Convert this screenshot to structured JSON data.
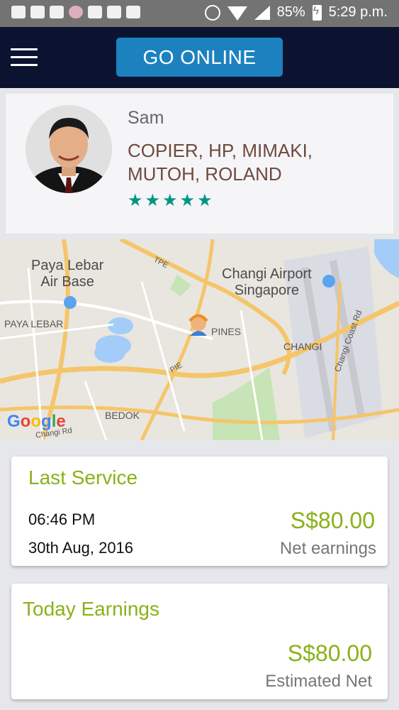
{
  "status_bar": {
    "battery": "85%",
    "time": "5:29 p.m."
  },
  "header": {
    "go_online_label": "GO ONLINE"
  },
  "profile": {
    "name": "Sam",
    "company_line1": "COPIER, HP, MIMAKI,",
    "company_line2": "MUTOH, ROLAND",
    "rating": 5,
    "stars": "★★★★★"
  },
  "map": {
    "labels": {
      "paya_lebar_air_base_line1": "Paya Lebar",
      "paya_lebar_air_base_line2": "Air Base",
      "changi_airport_line1": "Changi Airport",
      "changi_airport_line2": "Singapore",
      "paya_lebar": "PAYA LEBAR",
      "tpe": "TPE",
      "pines": "PINES",
      "changi": "CHANGI",
      "changi_coast_rd": "Changi Coast Rd",
      "pie": "PIE",
      "bedok": "BEDOK",
      "changi_rd": "Changi Rd",
      "google": "Google"
    }
  },
  "last_service": {
    "title": "Last Service",
    "time": "06:46 PM",
    "date": "30th Aug, 2016",
    "amount": "S$80.00",
    "amount_label": "Net earnings"
  },
  "today_earnings": {
    "title": "Today Earnings",
    "amount": "S$80.00",
    "amount_label": "Estimated Net"
  },
  "colors": {
    "header_bg": "#0c1330",
    "go_online_bg": "#1c82bf",
    "accent_green": "#8ab11a",
    "star_teal": "#009486",
    "company_brown": "#6e4a3e"
  }
}
